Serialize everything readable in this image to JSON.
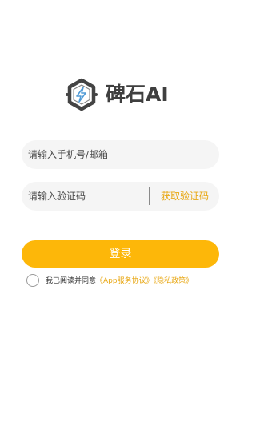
{
  "brand": {
    "name": "碑石AI"
  },
  "login_form": {
    "account_placeholder": "请输入手机号/邮箱",
    "code_placeholder": "请输入验证码",
    "get_code_label": "获取验证码",
    "submit_label": "登录"
  },
  "agreement": {
    "prefix": "我已阅读并同意",
    "app_service_link": "《App服务协议》",
    "privacy_link": "《隐私政策》",
    "checked": false
  },
  "colors": {
    "accent": "#fdb709",
    "link": "#e8a712",
    "field_bg": "#f5f5f5"
  },
  "icons": [
    "hexagon-bolt-logo-icon"
  ]
}
